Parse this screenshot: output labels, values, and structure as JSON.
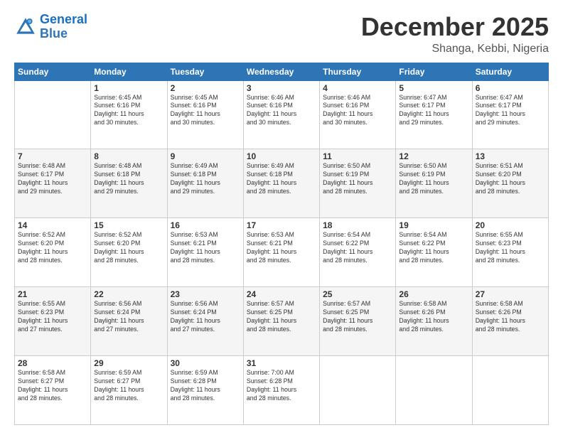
{
  "logo": {
    "line1": "General",
    "line2": "Blue"
  },
  "title": "December 2025",
  "location": "Shanga, Kebbi, Nigeria",
  "days": [
    "Sunday",
    "Monday",
    "Tuesday",
    "Wednesday",
    "Thursday",
    "Friday",
    "Saturday"
  ],
  "weeks": [
    [
      {
        "num": "",
        "info": ""
      },
      {
        "num": "1",
        "info": "Sunrise: 6:45 AM\nSunset: 6:16 PM\nDaylight: 11 hours\nand 30 minutes."
      },
      {
        "num": "2",
        "info": "Sunrise: 6:45 AM\nSunset: 6:16 PM\nDaylight: 11 hours\nand 30 minutes."
      },
      {
        "num": "3",
        "info": "Sunrise: 6:46 AM\nSunset: 6:16 PM\nDaylight: 11 hours\nand 30 minutes."
      },
      {
        "num": "4",
        "info": "Sunrise: 6:46 AM\nSunset: 6:16 PM\nDaylight: 11 hours\nand 30 minutes."
      },
      {
        "num": "5",
        "info": "Sunrise: 6:47 AM\nSunset: 6:17 PM\nDaylight: 11 hours\nand 29 minutes."
      },
      {
        "num": "6",
        "info": "Sunrise: 6:47 AM\nSunset: 6:17 PM\nDaylight: 11 hours\nand 29 minutes."
      }
    ],
    [
      {
        "num": "7",
        "info": "Sunrise: 6:48 AM\nSunset: 6:17 PM\nDaylight: 11 hours\nand 29 minutes."
      },
      {
        "num": "8",
        "info": "Sunrise: 6:48 AM\nSunset: 6:18 PM\nDaylight: 11 hours\nand 29 minutes."
      },
      {
        "num": "9",
        "info": "Sunrise: 6:49 AM\nSunset: 6:18 PM\nDaylight: 11 hours\nand 29 minutes."
      },
      {
        "num": "10",
        "info": "Sunrise: 6:49 AM\nSunset: 6:18 PM\nDaylight: 11 hours\nand 28 minutes."
      },
      {
        "num": "11",
        "info": "Sunrise: 6:50 AM\nSunset: 6:19 PM\nDaylight: 11 hours\nand 28 minutes."
      },
      {
        "num": "12",
        "info": "Sunrise: 6:50 AM\nSunset: 6:19 PM\nDaylight: 11 hours\nand 28 minutes."
      },
      {
        "num": "13",
        "info": "Sunrise: 6:51 AM\nSunset: 6:20 PM\nDaylight: 11 hours\nand 28 minutes."
      }
    ],
    [
      {
        "num": "14",
        "info": "Sunrise: 6:52 AM\nSunset: 6:20 PM\nDaylight: 11 hours\nand 28 minutes."
      },
      {
        "num": "15",
        "info": "Sunrise: 6:52 AM\nSunset: 6:20 PM\nDaylight: 11 hours\nand 28 minutes."
      },
      {
        "num": "16",
        "info": "Sunrise: 6:53 AM\nSunset: 6:21 PM\nDaylight: 11 hours\nand 28 minutes."
      },
      {
        "num": "17",
        "info": "Sunrise: 6:53 AM\nSunset: 6:21 PM\nDaylight: 11 hours\nand 28 minutes."
      },
      {
        "num": "18",
        "info": "Sunrise: 6:54 AM\nSunset: 6:22 PM\nDaylight: 11 hours\nand 28 minutes."
      },
      {
        "num": "19",
        "info": "Sunrise: 6:54 AM\nSunset: 6:22 PM\nDaylight: 11 hours\nand 28 minutes."
      },
      {
        "num": "20",
        "info": "Sunrise: 6:55 AM\nSunset: 6:23 PM\nDaylight: 11 hours\nand 28 minutes."
      }
    ],
    [
      {
        "num": "21",
        "info": "Sunrise: 6:55 AM\nSunset: 6:23 PM\nDaylight: 11 hours\nand 27 minutes."
      },
      {
        "num": "22",
        "info": "Sunrise: 6:56 AM\nSunset: 6:24 PM\nDaylight: 11 hours\nand 27 minutes."
      },
      {
        "num": "23",
        "info": "Sunrise: 6:56 AM\nSunset: 6:24 PM\nDaylight: 11 hours\nand 27 minutes."
      },
      {
        "num": "24",
        "info": "Sunrise: 6:57 AM\nSunset: 6:25 PM\nDaylight: 11 hours\nand 28 minutes."
      },
      {
        "num": "25",
        "info": "Sunrise: 6:57 AM\nSunset: 6:25 PM\nDaylight: 11 hours\nand 28 minutes."
      },
      {
        "num": "26",
        "info": "Sunrise: 6:58 AM\nSunset: 6:26 PM\nDaylight: 11 hours\nand 28 minutes."
      },
      {
        "num": "27",
        "info": "Sunrise: 6:58 AM\nSunset: 6:26 PM\nDaylight: 11 hours\nand 28 minutes."
      }
    ],
    [
      {
        "num": "28",
        "info": "Sunrise: 6:58 AM\nSunset: 6:27 PM\nDaylight: 11 hours\nand 28 minutes."
      },
      {
        "num": "29",
        "info": "Sunrise: 6:59 AM\nSunset: 6:27 PM\nDaylight: 11 hours\nand 28 minutes."
      },
      {
        "num": "30",
        "info": "Sunrise: 6:59 AM\nSunset: 6:28 PM\nDaylight: 11 hours\nand 28 minutes."
      },
      {
        "num": "31",
        "info": "Sunrise: 7:00 AM\nSunset: 6:28 PM\nDaylight: 11 hours\nand 28 minutes."
      },
      {
        "num": "",
        "info": ""
      },
      {
        "num": "",
        "info": ""
      },
      {
        "num": "",
        "info": ""
      }
    ]
  ]
}
